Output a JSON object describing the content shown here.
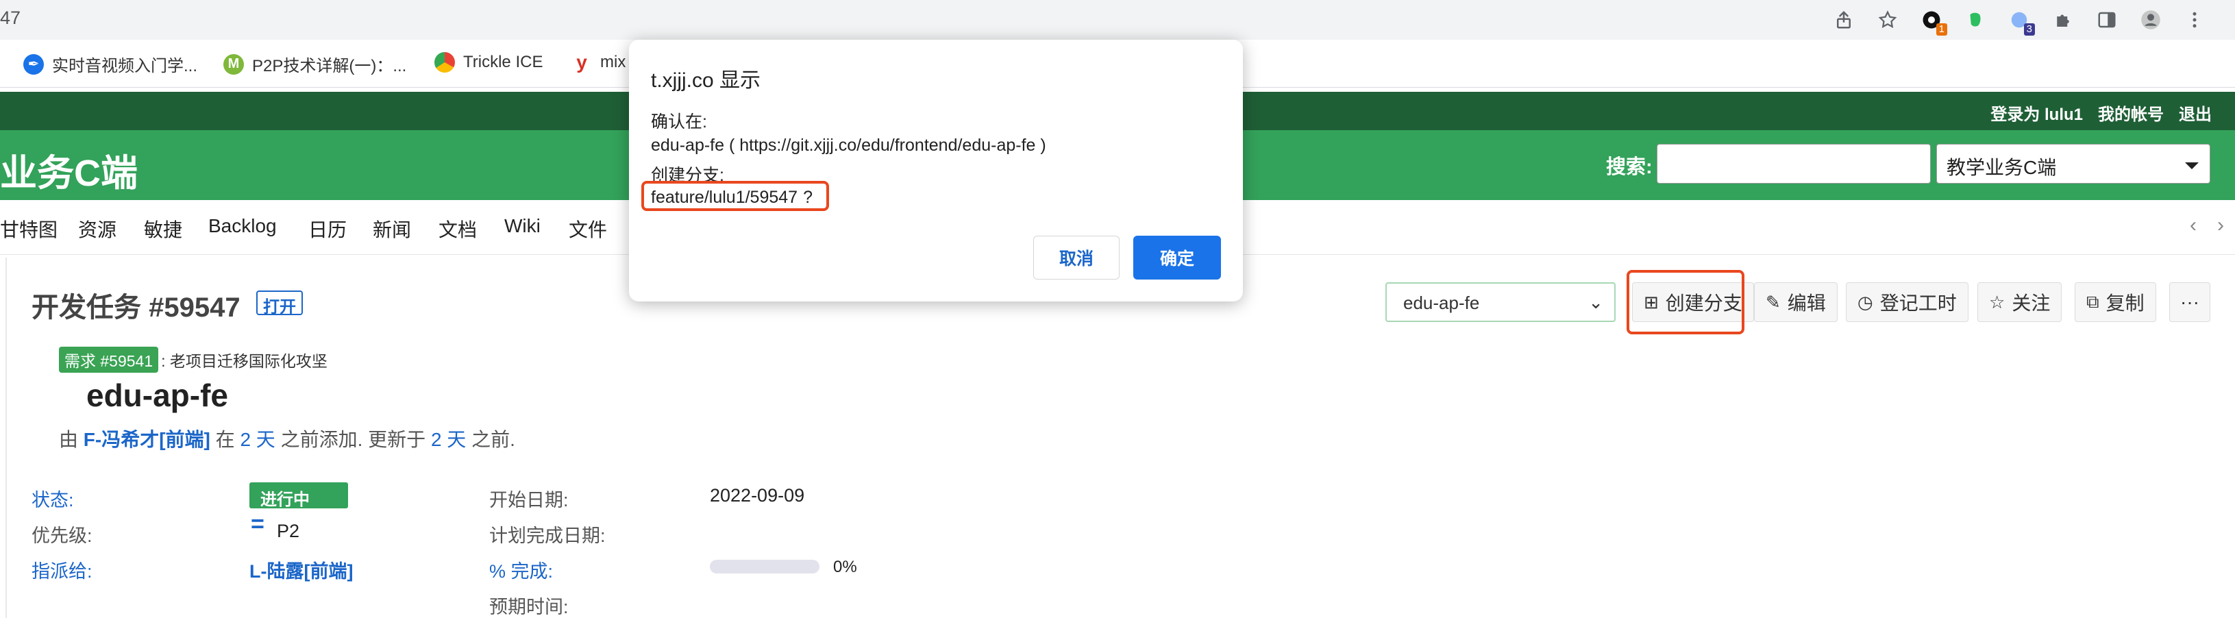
{
  "browser": {
    "address_fragment": "47",
    "bookmarks": [
      {
        "label": "实时音视频入门学...",
        "icon": "pen-nib-icon",
        "color": "#1a73e8"
      },
      {
        "label": "P2P技术详解(一)：...",
        "icon": "leaf-logo-icon",
        "color": "#7fb83a"
      },
      {
        "label": "Trickle ICE",
        "icon": "chrome-logo-icon",
        "color": "#e94235"
      },
      {
        "label": "mix",
        "icon": "y-logo-icon",
        "color": "#d93025"
      }
    ],
    "extension_badges": {
      "first": "1",
      "second": "3"
    }
  },
  "dialog": {
    "title": "t.xjjj.co 显示",
    "confirm_label": "确认在:",
    "repo_line": "edu-ap-fe ( https://git.xjjj.co/edu/frontend/edu-ap-fe )",
    "create_label": "创建分支:",
    "branch_name": "feature/lulu1/59547",
    "question_mark": "?",
    "cancel_label": "取消",
    "ok_label": "确定"
  },
  "top_menu": {
    "logged_in": "登录为 lulu1",
    "my_account": "我的帐号",
    "logout": "退出"
  },
  "header": {
    "project_title": "业务C端",
    "search_label": "搜索:",
    "search_value": "",
    "project_selected": "教学业务C端"
  },
  "main_menu": {
    "items": [
      "甘特图",
      "资源",
      "敏捷",
      "Backlog",
      "日历",
      "新闻",
      "文档",
      "Wiki",
      "文件"
    ],
    "prev_arrow": "‹",
    "next_arrow": "›"
  },
  "issue": {
    "title": "开发任务 #59547",
    "status_tag": "打开",
    "parent_tag": "需求 #59541",
    "parent_subject": ": 老项目迁移国际化攻坚",
    "subject": "edu-ap-fe",
    "author_prefix": "由",
    "author": "F-冯希才[前端]",
    "added_mid": "在",
    "added_ago": "2 天",
    "added_suffix": "之前添加. 更新于",
    "updated_ago": "2 天",
    "updated_suffix": "之前.",
    "branch_selected": "edu-ap-fe",
    "actions": {
      "create_branch": "创建分支",
      "edit": "编辑",
      "log_time": "登记工时",
      "watch": "关注",
      "copy": "复制",
      "more": "···"
    },
    "attributes": {
      "status_label": "状态:",
      "status_value": "进行中",
      "priority_label": "优先级:",
      "priority_value": "P2",
      "assignee_label": "指派给:",
      "assignee_value": "L-陆露[前端]",
      "start_label": "开始日期:",
      "start_value": "2022-09-09",
      "due_label": "计划完成日期:",
      "done_label": "% 完成:",
      "done_percent": 0,
      "done_text": "0%",
      "estimated_label": "预期时间:"
    }
  },
  "colors": {
    "top_menu_bg": "#1f5f36",
    "header_bg": "#33a25a",
    "link_blue": "#1b66c9",
    "highlight_red": "#e9471f",
    "dialog_ok_blue": "#1a73e8"
  }
}
